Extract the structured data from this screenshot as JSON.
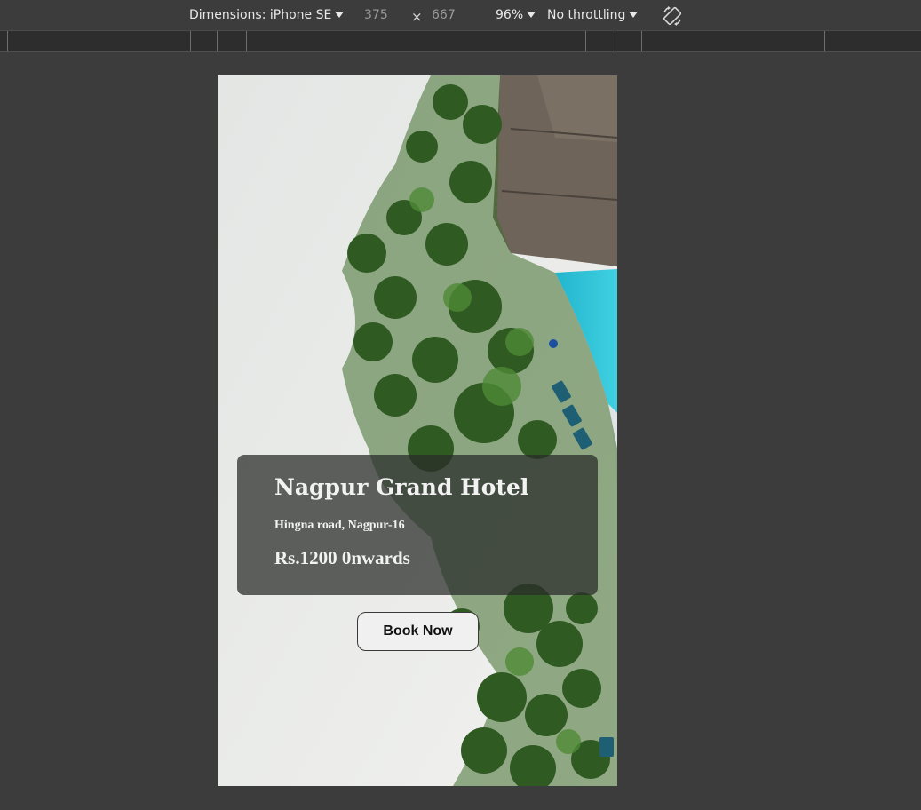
{
  "devtools": {
    "device_label": "Dimensions: iPhone SE",
    "width_value": "375",
    "times_symbol": "×",
    "height_value": "667",
    "zoom_label": "96%",
    "throttling_label": "No throttling",
    "rotate_icon": "rotate-device-icon"
  },
  "hotel": {
    "name": "Nagpur Grand Hotel",
    "address": "Hingna road, Nagpur-16",
    "price": "Rs.1200 0nwards",
    "button_label": "Book Now"
  },
  "colors": {
    "devtools_bg": "#3c3c3c",
    "sand": "#ecedeb",
    "palm": "#3a6b2a",
    "pool": "#2fc1d6",
    "roof": "#6b6156",
    "card_overlay": "#2a2c2a"
  }
}
